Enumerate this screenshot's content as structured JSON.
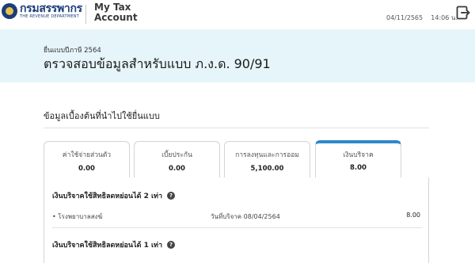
{
  "header": {
    "logo_th": "กรมสรรพากร",
    "logo_en": "THE REVENUE DEPARTMENT",
    "app_line1": "My Tax",
    "app_line2": "Account",
    "date": "04/11/2565",
    "time": "14:06 น.",
    "logout_icon": "logout-icon"
  },
  "title_band": {
    "subtitle": "ยื่นแบบปีภาษี 2564",
    "title": "ตรวจสอบข้อมูลสำหรับแบบ ภ.ง.ด. 90/91"
  },
  "section": {
    "title": "ข้อมูลเบื้องต้นที่นำไปใช้ยื่นแบบ"
  },
  "tabs": [
    {
      "label": "ค่าใช้จ่ายส่วนตัว",
      "value": "0.00"
    },
    {
      "label": "เบี้ยประกัน",
      "value": "0.00"
    },
    {
      "label": "การลงทุนและการออม",
      "value": "5,100.00"
    },
    {
      "label": "เงินบริจาค",
      "value": "8.00",
      "active": true
    }
  ],
  "donations": {
    "group1_title": "เงินบริจาคใช้สิทธิลดหย่อนได้ 2 เท่า",
    "group1_rows": [
      {
        "name": "• โรงพยาบาลสงฆ์",
        "date": "วันที่บริจาค 08/04/2564",
        "amount": "8.00"
      }
    ],
    "group2_title": "เงินบริจาคใช้สิทธิลดหย่อนได้ 1 เท่า"
  },
  "colors": {
    "band_bg": "#e6f5fa",
    "active_tab_accent": "#2f88c9",
    "logo_blue": "#1c3d7a"
  }
}
